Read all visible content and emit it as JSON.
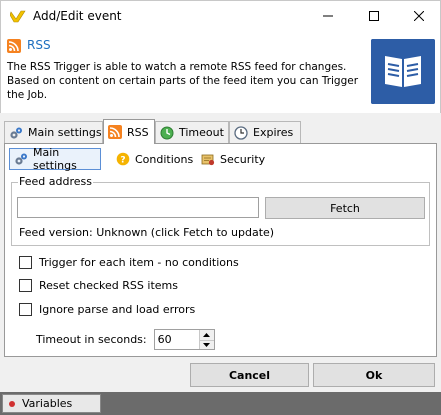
{
  "window": {
    "title": "Add/Edit event",
    "icons": {
      "app": "chevron-logo-icon",
      "minimize": "minimize-icon",
      "maximize": "maximize-icon",
      "close": "close-icon"
    }
  },
  "header": {
    "title": "RSS",
    "description": "The RSS Trigger is able to watch a remote RSS feed for changes. Based on content on certain parts of the feed item you can Trigger the Job.",
    "icon": "rss-icon",
    "illustration": "book-icon"
  },
  "tabs": [
    {
      "label": "Main settings",
      "icon": "gears-icon"
    },
    {
      "label": "RSS",
      "icon": "rss-icon",
      "active": true
    },
    {
      "label": "Timeout",
      "icon": "timeout-icon"
    },
    {
      "label": "Expires",
      "icon": "clock-icon"
    }
  ],
  "subtabs": [
    {
      "label": "Main settings",
      "icon": "gears-icon",
      "active": true
    },
    {
      "label": "Conditions",
      "icon": "help-icon"
    },
    {
      "label": "Security",
      "icon": "security-icon"
    }
  ],
  "feed": {
    "legend": "Feed address",
    "value": "",
    "fetch_label": "Fetch",
    "version_text": "Feed version: Unknown (click Fetch to update)"
  },
  "options": [
    {
      "label": "Trigger for each item - no conditions",
      "checked": false
    },
    {
      "label": "Reset checked RSS items",
      "checked": false
    },
    {
      "label": "Ignore parse and load errors",
      "checked": false
    }
  ],
  "timeout": {
    "label": "Timeout in seconds:",
    "value": "60"
  },
  "buttons": {
    "cancel": "Cancel",
    "ok": "Ok"
  },
  "statusbar": {
    "variables_label": "Variables"
  },
  "colors": {
    "rss": "#f58220",
    "header_title": "#1f6fbf",
    "book": "#2d5da6",
    "statusbar": "#6b6b6b",
    "subtab_active_border": "#5b8fd6"
  }
}
